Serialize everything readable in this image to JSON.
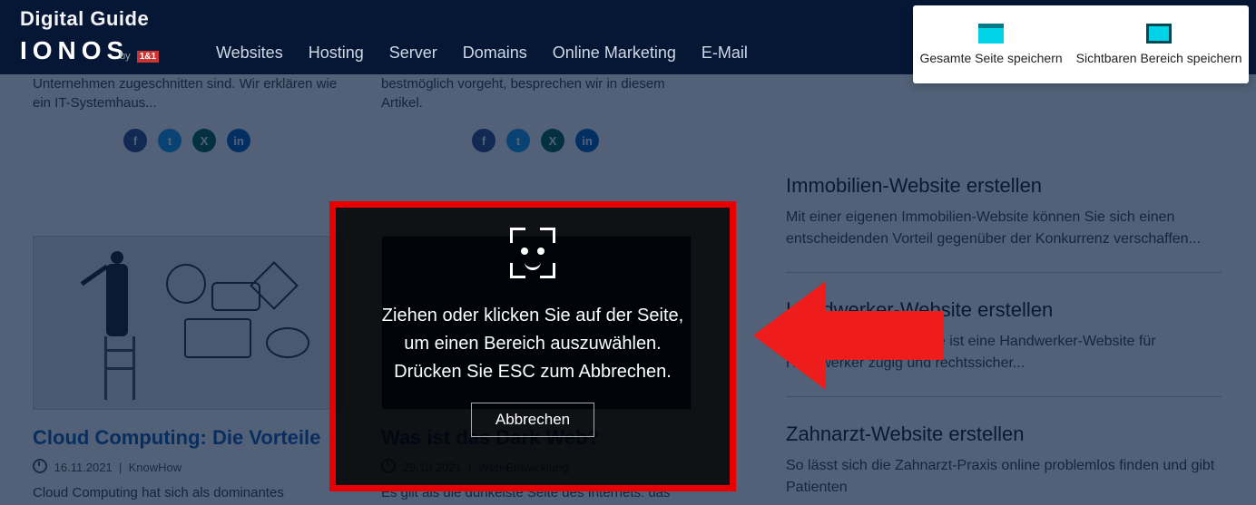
{
  "header": {
    "brand": "Digital Guide",
    "logo": "IONOS",
    "by": "by",
    "by_tag": "1&1",
    "nav": [
      "Websites",
      "Hosting",
      "Server",
      "Domains",
      "Online Marketing",
      "E-Mail"
    ]
  },
  "card1": {
    "text": "Unternehmen zugeschnitten sind. Wir erklären wie ein IT-Systemhaus..."
  },
  "card2": {
    "text": "bestmöglich vorgeht, besprechen wir in diesem Artikel."
  },
  "card3": {
    "title": "Cloud Computing: Die Vorteile",
    "date": "16.11.2021",
    "category": "KnowHow",
    "excerpt": "Cloud Computing hat sich als dominantes"
  },
  "card4": {
    "title": "Was ist das Dark Web?",
    "date": "29.10.2021",
    "category": "Web-Entwicklung",
    "excerpt": "Es gilt als die dunkelste Seite des Internets: das"
  },
  "sidebar": {
    "items": [
      {
        "title": "Immobilien-Website erstellen",
        "text": "Mit einer eigenen Immobilien-Website können Sie sich einen entscheidenden Vorteil gegenüber der Konkurrenz verschaffen..."
      },
      {
        "title": "Handwerker-Website erstellen",
        "text": "Mit der richtigen Website ist eine Handwerker-Website für Handwerker zügig und rechtssicher..."
      },
      {
        "title": "Zahnarzt-Website erstellen",
        "text": "So lässt sich die Zahnarzt-Praxis online problemlos finden und gibt Patienten"
      }
    ]
  },
  "capture": {
    "line1": "Ziehen oder klicken Sie auf der Seite,",
    "line2": "um einen Bereich auszuwählen.",
    "line3": "Drücken Sie ESC zum Abbrechen.",
    "cancel": "Abbrechen"
  },
  "toolbar": {
    "save_full": "Gesamte Seite speichern",
    "save_visible": "Sichtbaren Bereich speichern"
  }
}
